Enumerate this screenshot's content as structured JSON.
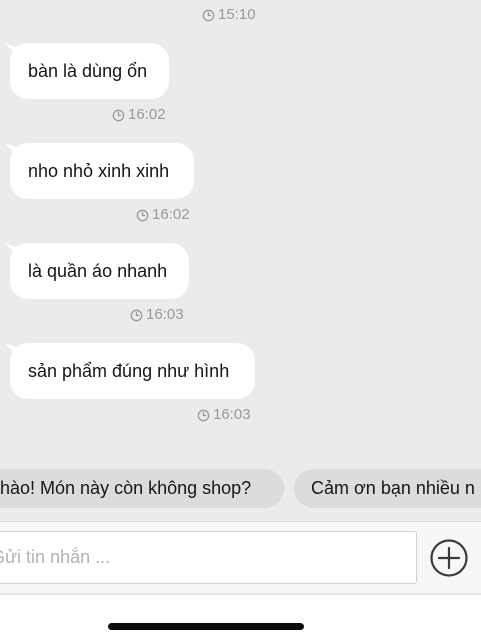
{
  "messages": [
    {
      "time": "15:10"
    },
    {
      "text": "bàn là dùng ổn",
      "time": "16:02"
    },
    {
      "text": "nho nhỏ xinh xinh",
      "time": "16:02"
    },
    {
      "text": "là quần áo nhanh",
      "time": "16:03"
    },
    {
      "text": "sản phẩm đúng như hình",
      "time": "16:03"
    }
  ],
  "quick_replies": [
    {
      "label": "hào! Món này còn không shop?"
    },
    {
      "label": "Cảm ơn bạn nhiều n"
    }
  ],
  "composer": {
    "placeholder": "Gửi tin nhắn ...",
    "add_icon": "plus-circle-icon"
  },
  "colors": {
    "background": "#ebebeb",
    "bubble": "#ffffff",
    "timestamp": "#9a9a9a",
    "chip": "#dcdcdc"
  }
}
